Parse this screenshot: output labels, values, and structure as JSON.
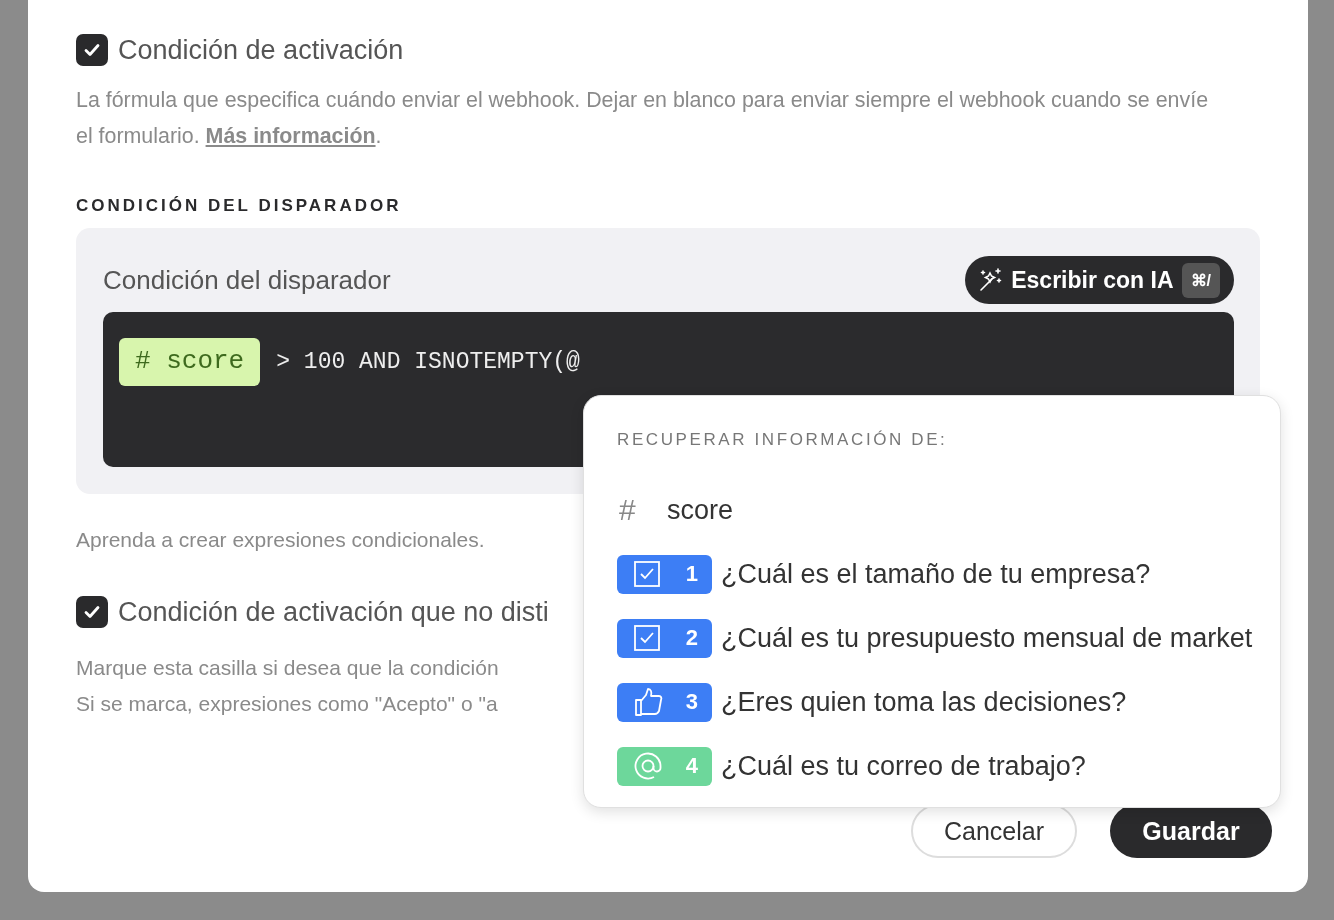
{
  "activation": {
    "label": "Condición de activación",
    "checked": true,
    "description": "La fórmula que especifica cuándo enviar el webhook. Dejar en blanco para enviar siempre el webhook cuando se envíe el formulario. ",
    "link": "Más información",
    "after": "."
  },
  "trigger": {
    "section_label": "CONDICIÓN DEL DISPARADOR",
    "title": "Condición del disparador",
    "ai_button": {
      "label": "Escribir con IA",
      "shortcut": "⌘/"
    },
    "token": {
      "symbol": "#",
      "name": "score"
    },
    "expression": "> 100 AND ISNOTEMPTY(@"
  },
  "help": "Aprenda a crear expresiones condicionales.",
  "case_option": {
    "label": "Condición de activación que no disti",
    "checked": true,
    "description": [
      "Marque esta casilla si desea que la condición",
      "Si se marca, expresiones como \"Acepto\" o \"a"
    ]
  },
  "buttons": [
    {
      "label": "Cancelar",
      "kind": "secondary"
    },
    {
      "label": "Guardar",
      "kind": "primary"
    }
  ],
  "popup": {
    "title": "RECUPERAR INFORMACIÓN DE:",
    "items": [
      {
        "kind": "variable",
        "symbol": "#",
        "label": "score"
      },
      {
        "kind": "checkbox",
        "number": "1",
        "label": "¿Cuál es el tamaño de tu empresa?",
        "color": "#3d7ef5"
      },
      {
        "kind": "checkbox",
        "number": "2",
        "label": "¿Cuál es tu presupuesto mensual de market",
        "color": "#3d7ef5"
      },
      {
        "kind": "thumb",
        "number": "3",
        "label": "¿Eres quien toma las decisiones?",
        "color": "#3d7ef5"
      },
      {
        "kind": "email",
        "number": "4",
        "label": "¿Cuál es tu correo de trabajo?",
        "color": "#6dd79b"
      }
    ]
  }
}
